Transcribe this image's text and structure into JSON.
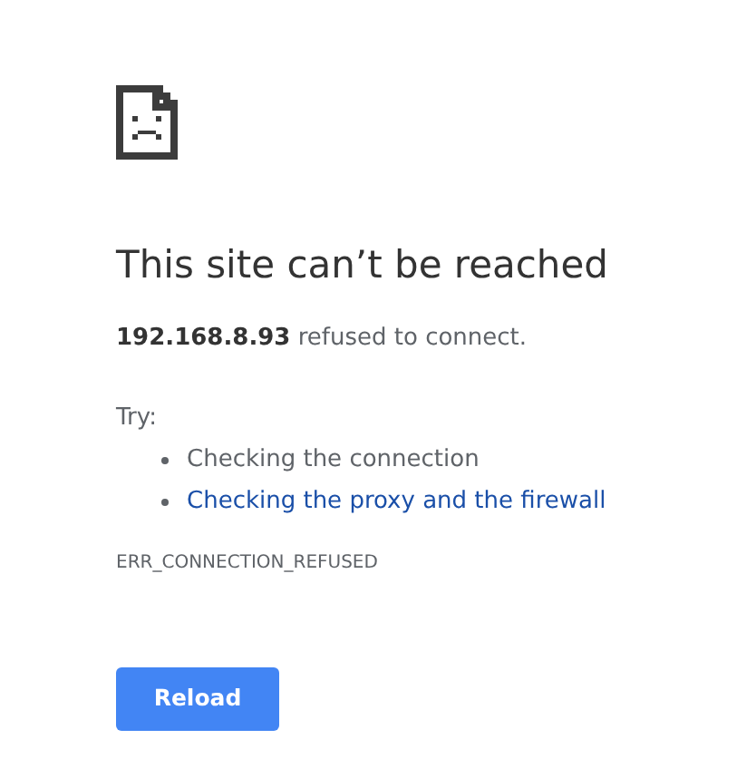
{
  "heading": "This site can’t be reached",
  "message": "**192.168.8.93** refused to connect.",
  "try_label": "Try:",
  "suggestions": [
    {
      "kind": "text",
      "text": "Checking the connection"
    },
    {
      "kind": "link",
      "text": "Checking the proxy and the firewall"
    }
  ],
  "error_code": "ERR_CONNECTION_REFUSED",
  "button": "Reload"
}
